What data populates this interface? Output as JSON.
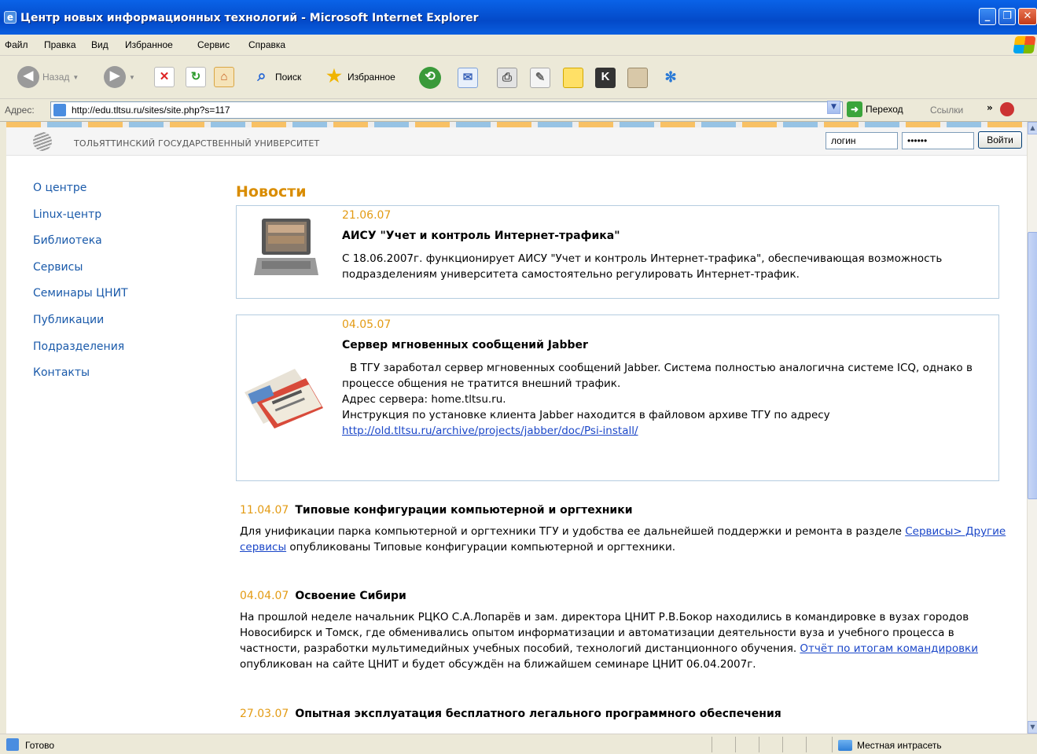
{
  "window": {
    "title": "Центр новых информационных технологий - Microsoft Internet Explorer"
  },
  "menu": [
    "Файл",
    "Правка",
    "Вид",
    "Избранное",
    "Сервис",
    "Справка"
  ],
  "toolbar": {
    "back": "Назад",
    "search": "Поиск",
    "favorites": "Избранное"
  },
  "address": {
    "label": "Адрес:",
    "url": "http://edu.tltsu.ru/sites/site.php?s=117",
    "go": "Переход",
    "links": "Ссылки",
    "more": "»"
  },
  "header": {
    "university": "ТОЛЬЯТТИНСКИЙ ГОСУДАРСТВЕННЫЙ УНИВЕРСИТЕТ",
    "login_value": "логин",
    "password_value": "••••••",
    "login_button": "Войти"
  },
  "sidebar": [
    "О центре",
    "Linux-центр",
    "Библиотека",
    "Сервисы",
    "Семинары ЦНИТ",
    "Публикации",
    "Подразделения",
    "Контакты"
  ],
  "news_heading": "Новости",
  "featured": [
    {
      "date": "21.06.07",
      "title": "АИСУ \"Учет и контроль Интернет-трафика\"",
      "text": "С 18.06.2007г. функционирует АИСУ \"Учет и контроль Интернет-трафика\", обеспечивающая возможность подразделениям университета самостоятельно регулировать Интернет-трафик."
    },
    {
      "date": "04.05.07",
      "title": "Сервер мгновенных сообщений Jabber",
      "line1": "В ТГУ заработал сервер мгновенных сообщений Jabber. Система полностью аналогична системе ICQ, однако в процессе общения не тратится внешний трафик.",
      "line2": "Адрес сервера: home.tltsu.ru.",
      "line3": "Инструкция по установке клиента Jabber находится в файловом архиве ТГУ по адресу",
      "link": "http://old.tltsu.ru/archive/projects/jabber/doc/Psi-install/"
    }
  ],
  "news": [
    {
      "date": "11.04.07",
      "title": "Типовые конфигурации компьютерной и оргтехники",
      "text_before": "Для унификации парка компьютерной и оргтехники ТГУ и удобства ее дальнейшей поддержки и ремонта в разделе",
      "link": "Сервисы> Другие сервисы",
      "text_after": "опубликованы Типовые конфигурации компьютерной и оргтехники."
    },
    {
      "date": "04.04.07",
      "title": "Освоение Сибири",
      "text_before": "На прошлой неделе начальник РЦКО С.А.Лопарёв и зам. директора ЦНИТ Р.В.Бокор находились в командировке в вузах городов Новосибирск и Томск, где обменивались опытом информатизации и автоматизации деятельности вуза и учебного процесса в частности, разработки мультимедийных учебных пособий, технологий дистанционного обучения.",
      "link": "Отчёт по итогам командировки",
      "text_after": "опубликован на сайте ЦНИТ и будет обсуждён на ближайшем семинаре ЦНИТ 06.04.2007г."
    },
    {
      "date": "27.03.07",
      "title": "Опытная эксплуатация бесплатного легального программного обеспечения"
    }
  ],
  "status": {
    "text": "Готово",
    "zone": "Местная интрасеть"
  }
}
